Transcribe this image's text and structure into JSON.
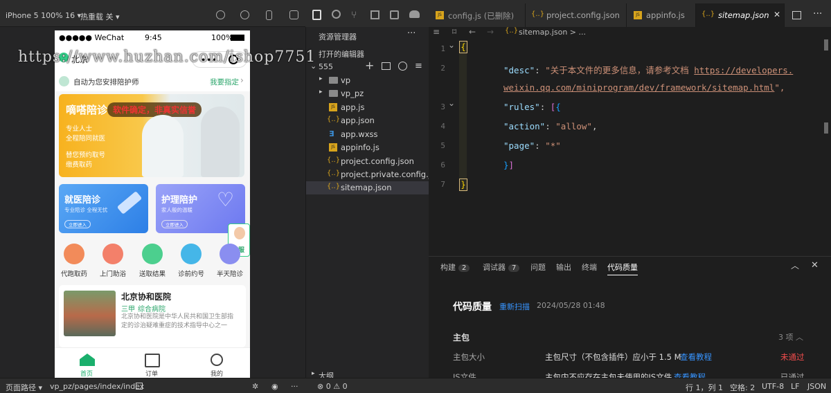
{
  "simulator": {
    "device": "iPhone 5 100% 16 ▾",
    "hot_reload": "热重载 关 ▾",
    "status": {
      "carrier": "●●●●● WeChat",
      "time": "9:45",
      "battery": "100%"
    },
    "nav": {
      "city": "北京"
    },
    "assign": {
      "text": "自动为您安排陪护师",
      "link": "我要指定"
    },
    "banner": {
      "title": "嘀嗒陪诊",
      "slogan": "软件确定，非真实信誉",
      "lines": [
        "专业人士",
        "全程陪同就医",
        "替您预约取号",
        "缴费取药"
      ]
    },
    "cards": [
      {
        "title": "就医陪诊",
        "sub": "专业陪诊 全程无忧",
        "btn": "立即进入"
      },
      {
        "title": "护理陪护",
        "sub": "家人般的温暖",
        "btn": "立即进入"
      }
    ],
    "kefu": "客服",
    "icons": [
      {
        "label": "代跑取药",
        "color": "#f28b5a"
      },
      {
        "label": "上门助浴",
        "color": "#f3806a"
      },
      {
        "label": "送取结果",
        "color": "#4ccf8e"
      },
      {
        "label": "诊前约号",
        "color": "#45b6e8"
      },
      {
        "label": "半天陪诊",
        "color": "#8a8ef0"
      }
    ],
    "hospital": {
      "name": "北京协和医院",
      "level": "三甲",
      "type": "综合病院",
      "desc": "北京协和医院是中华人民共和国卫生部指定的诊治疑难重症的技术指导中心之一"
    },
    "tabbar": [
      {
        "label": "首页",
        "active": true
      },
      {
        "label": "订单",
        "active": false
      },
      {
        "label": "我的",
        "active": false
      }
    ]
  },
  "watermark": "https://www.huzhan.com/ishop7751",
  "explorer": {
    "title": "资源管理器",
    "open_editors": "打开的编辑器",
    "project": "555",
    "outline": "大纲",
    "files": [
      {
        "name": "vp",
        "type": "folder"
      },
      {
        "name": "vp_pz",
        "type": "folder"
      },
      {
        "name": "app.js",
        "type": "js"
      },
      {
        "name": "app.json",
        "type": "json"
      },
      {
        "name": "app.wxss",
        "type": "wxss"
      },
      {
        "name": "appinfo.js",
        "type": "js"
      },
      {
        "name": "project.config.json",
        "type": "json"
      },
      {
        "name": "project.private.config.js...",
        "type": "json"
      },
      {
        "name": "sitemap.json",
        "type": "json"
      }
    ]
  },
  "tabs": [
    {
      "label": "config.js (已删除)",
      "icon": "JS"
    },
    {
      "label": "project.config.json",
      "icon": "{..}"
    },
    {
      "label": "appinfo.js",
      "icon": "JS"
    },
    {
      "label": "sitemap.json",
      "icon": "{..}",
      "active": true
    }
  ],
  "breadcrumb": "sitemap.json > ...",
  "code": {
    "line_numbers": [
      "1",
      "2",
      "3",
      "4",
      "5",
      "6",
      "7"
    ],
    "desc_key": "\"desc\"",
    "desc_val": "\"关于本文件的更多信息，请参考文档 ",
    "url1": "https://developers.",
    "url2": "weixin.qq.com/miniprogram/dev/framework/sitemap.html",
    "desc_end": "\",",
    "rules_key": "\"rules\"",
    "action_key": "\"action\"",
    "action_val": "\"allow\"",
    "page_key": "\"page\"",
    "page_val": "\"*\""
  },
  "panel": {
    "tabs": [
      {
        "label": "构建",
        "count": "2"
      },
      {
        "label": "调试器",
        "count": "7"
      },
      {
        "label": "问题"
      },
      {
        "label": "输出"
      },
      {
        "label": "终端"
      },
      {
        "label": "代码质量",
        "active": true
      }
    ],
    "heading": "代码质量",
    "rescan": "重新扫描",
    "date": "2024/05/28 01:48",
    "section": "主包",
    "section_count": "3 项 ︿",
    "rows": [
      {
        "key": "主包大小",
        "desc": "主包尺寸（不包含插件）应小于 1.5 M",
        "link": "查看教程",
        "status": "未通过"
      },
      {
        "key": "JS文件",
        "desc": "主包内不应存在主包未使用的JS文件",
        "link": "查看教程",
        "status": "已通过"
      }
    ]
  },
  "statusbar": {
    "path_label": "页面路径 ▾",
    "path": "vp_pz/pages/index/index",
    "problems": "⊗ 0 ⚠ 0",
    "position": "行 1，列 1",
    "spaces": "空格: 2",
    "encoding": "UTF-8",
    "eol": "LF",
    "language": "JSON"
  }
}
